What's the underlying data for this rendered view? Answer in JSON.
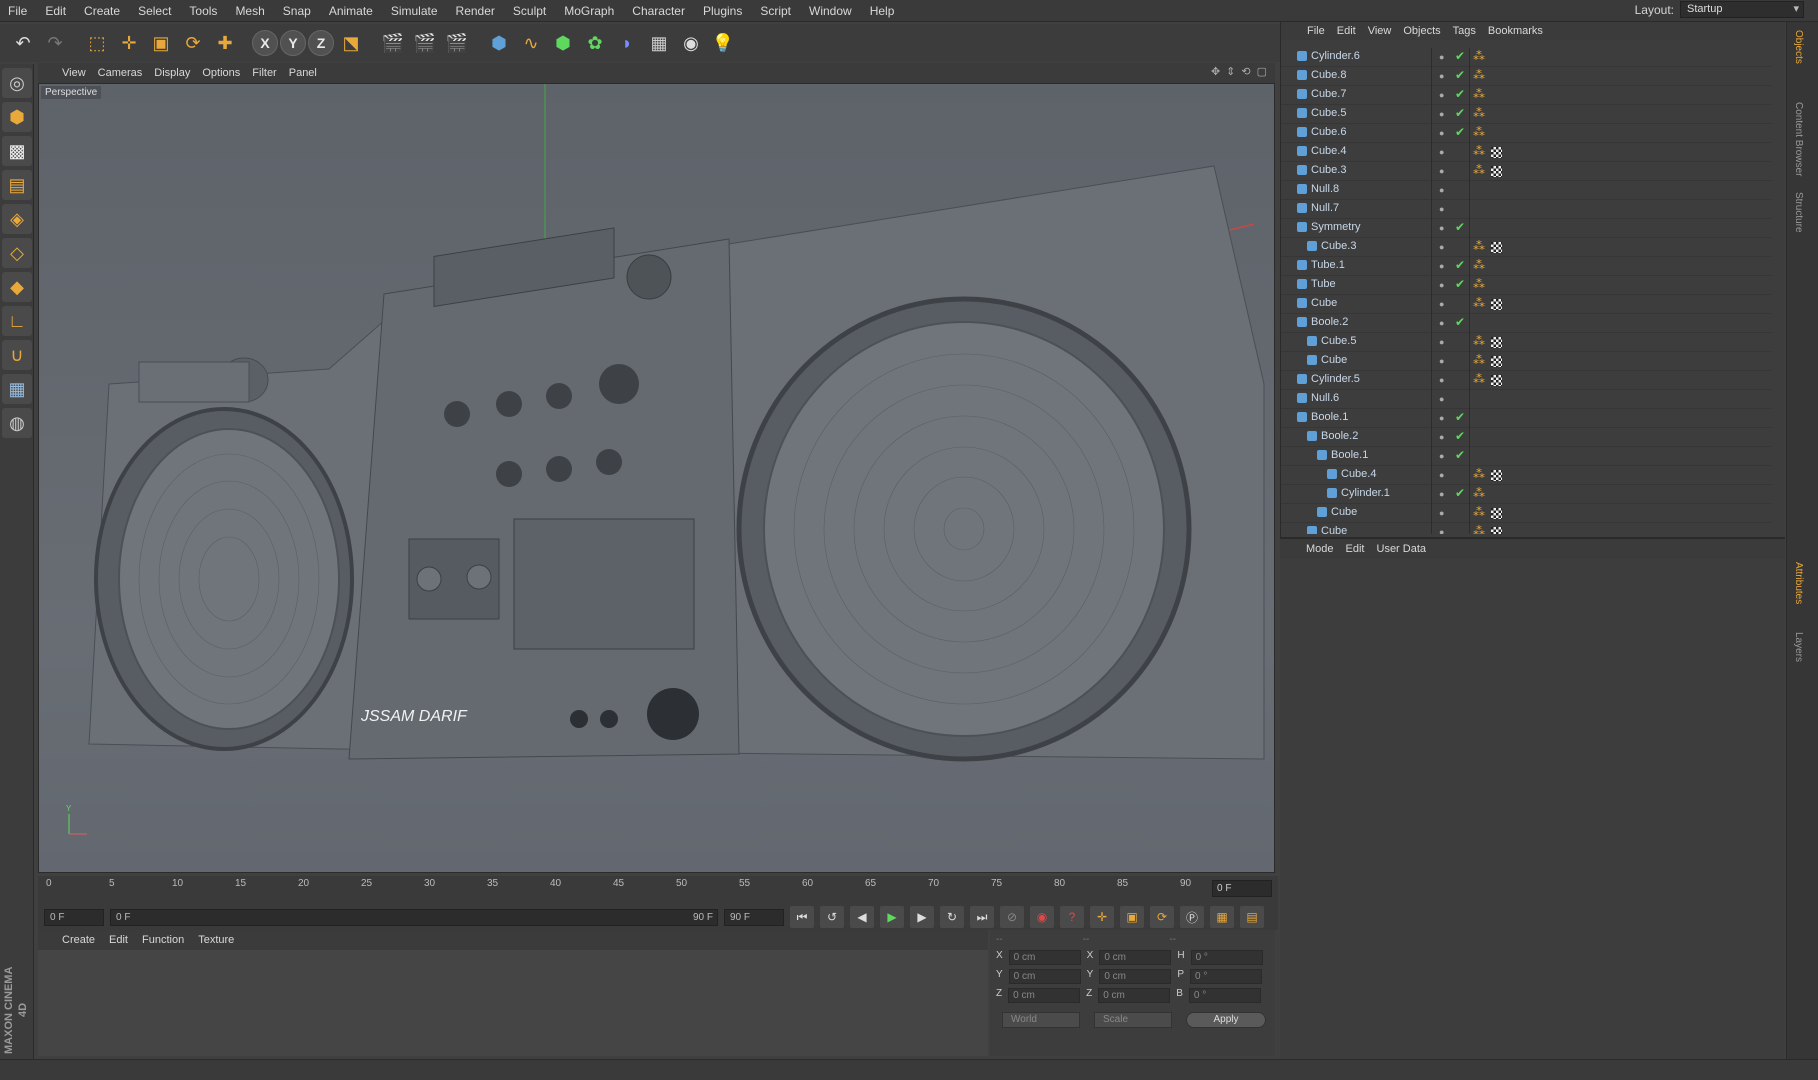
{
  "menubar": {
    "items": [
      "File",
      "Edit",
      "Create",
      "Select",
      "Tools",
      "Mesh",
      "Snap",
      "Animate",
      "Simulate",
      "Render",
      "Sculpt",
      "MoGraph",
      "Character",
      "Plugins",
      "Script",
      "Window",
      "Help"
    ],
    "layout_label": "Layout:",
    "layout_value": "Startup"
  },
  "viewport": {
    "menu": [
      "View",
      "Cameras",
      "Display",
      "Options",
      "Filter",
      "Panel"
    ],
    "label": "Perspective",
    "watermark": "JSSAM DARIF"
  },
  "timeline": {
    "ticks": [
      "0",
      "5",
      "10",
      "15",
      "20",
      "25",
      "30",
      "35",
      "40",
      "45",
      "50",
      "55",
      "60",
      "65",
      "70",
      "75",
      "80",
      "85",
      "90"
    ],
    "current_frame": "0 F"
  },
  "transport": {
    "start": "0 F",
    "range_start": "0 F",
    "range_end": "90 F",
    "end": "90 F"
  },
  "material": {
    "menu": [
      "Create",
      "Edit",
      "Function",
      "Texture"
    ]
  },
  "coords": {
    "header_left": "--",
    "header_mid": "--",
    "header_right": "--",
    "rows": [
      {
        "a": "X",
        "av": "0 cm",
        "b": "X",
        "bv": "0 cm",
        "c": "H",
        "cv": "0 °"
      },
      {
        "a": "Y",
        "av": "0 cm",
        "b": "Y",
        "bv": "0 cm",
        "c": "P",
        "cv": "0 °"
      },
      {
        "a": "Z",
        "av": "0 cm",
        "b": "Z",
        "bv": "0 cm",
        "c": "B",
        "cv": "0 °"
      }
    ],
    "world": "World",
    "scale": "Scale",
    "apply": "Apply"
  },
  "objects": {
    "menu": [
      "File",
      "Edit",
      "View",
      "Objects",
      "Tags",
      "Bookmarks"
    ],
    "items": [
      {
        "name": "Cylinder.6",
        "indent": 0,
        "check": true,
        "checker": false
      },
      {
        "name": "Cube.8",
        "indent": 0,
        "check": true,
        "checker": false
      },
      {
        "name": "Cube.7",
        "indent": 0,
        "check": true,
        "checker": false
      },
      {
        "name": "Cube.5",
        "indent": 0,
        "check": true,
        "checker": false
      },
      {
        "name": "Cube.6",
        "indent": 0,
        "check": true,
        "checker": false
      },
      {
        "name": "Cube.4",
        "indent": 0,
        "check": false,
        "checker": true
      },
      {
        "name": "Cube.3",
        "indent": 0,
        "check": false,
        "checker": true
      },
      {
        "name": "Null.8",
        "indent": 0,
        "check": false,
        "checker": false,
        "tag": false
      },
      {
        "name": "Null.7",
        "indent": 0,
        "check": false,
        "checker": false,
        "tag": false
      },
      {
        "name": "Symmetry",
        "indent": 0,
        "check": true,
        "checker": false,
        "tag": false
      },
      {
        "name": "Cube.3",
        "indent": 1,
        "check": false,
        "checker": true
      },
      {
        "name": "Tube.1",
        "indent": 0,
        "check": true,
        "checker": false
      },
      {
        "name": "Tube",
        "indent": 0,
        "check": true,
        "checker": false
      },
      {
        "name": "Cube",
        "indent": 0,
        "check": false,
        "checker": true
      },
      {
        "name": "Boole.2",
        "indent": 0,
        "check": true,
        "checker": false,
        "tag": false
      },
      {
        "name": "Cube.5",
        "indent": 1,
        "check": false,
        "checker": true
      },
      {
        "name": "Cube",
        "indent": 1,
        "check": false,
        "checker": true
      },
      {
        "name": "Cylinder.5",
        "indent": 0,
        "check": false,
        "checker": true
      },
      {
        "name": "Null.6",
        "indent": 0,
        "check": false,
        "checker": false,
        "tag": false
      },
      {
        "name": "Boole.1",
        "indent": 0,
        "check": true,
        "checker": false,
        "tag": false
      },
      {
        "name": "Boole.2",
        "indent": 1,
        "check": true,
        "checker": false,
        "tag": false
      },
      {
        "name": "Boole.1",
        "indent": 2,
        "check": true,
        "checker": false,
        "tag": false
      },
      {
        "name": "Cube.4",
        "indent": 3,
        "check": false,
        "checker": true
      },
      {
        "name": "Cylinder.1",
        "indent": 3,
        "check": true,
        "checker": false
      },
      {
        "name": "Cube",
        "indent": 2,
        "check": false,
        "checker": true
      },
      {
        "name": "Cube",
        "indent": 1,
        "check": false,
        "checker": true
      }
    ]
  },
  "attributes": {
    "menu": [
      "Mode",
      "Edit",
      "User Data"
    ]
  },
  "righttabs": [
    "Objects",
    "Content Browser",
    "Structure",
    "Attributes",
    "Layers"
  ],
  "icons": {
    "undo": "undo-icon",
    "redo": "redo-icon",
    "move": "move-icon",
    "scale": "scale-icon",
    "rotate": "rotate-icon"
  },
  "colors": {
    "accent": "#e8a83a",
    "check": "#5fd85f",
    "object": "#5fa0d8"
  }
}
